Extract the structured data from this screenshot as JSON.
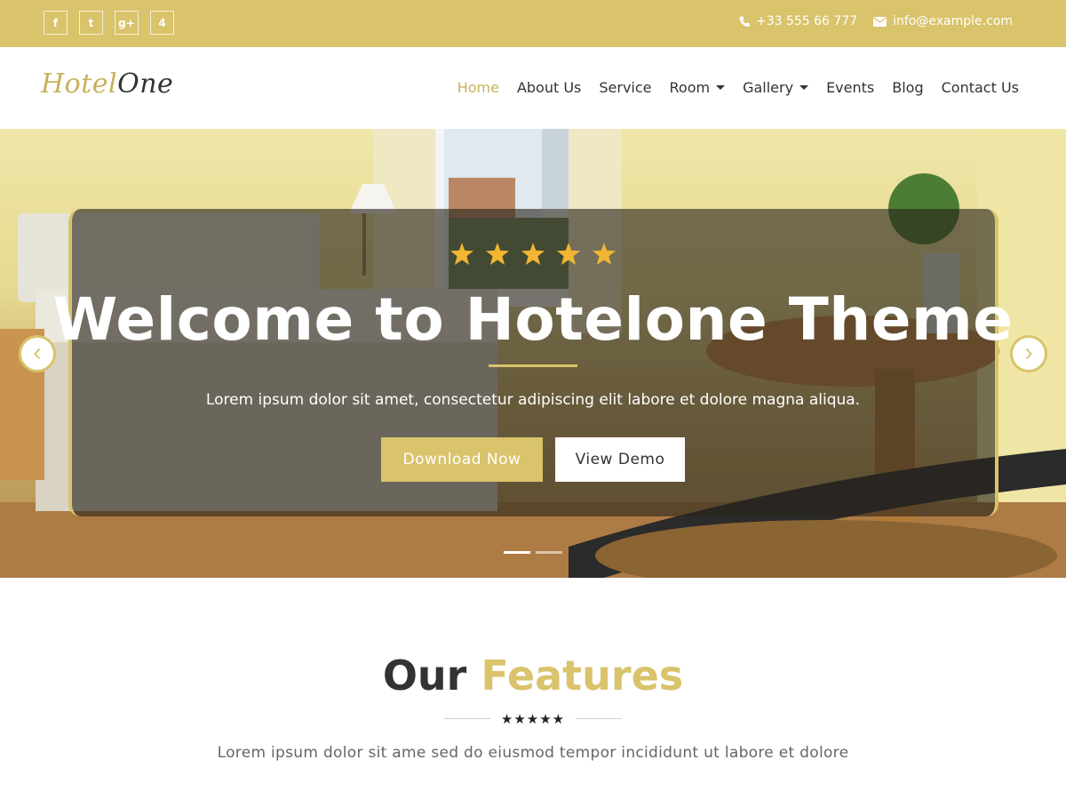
{
  "topbar": {
    "social": [
      {
        "label": "f",
        "icon": "facebook-icon"
      },
      {
        "label": "t",
        "icon": "twitter-icon"
      },
      {
        "label": "g+",
        "icon": "google-plus-icon"
      },
      {
        "label": "4",
        "icon": "foursquare-icon"
      }
    ],
    "phone": "+33 555 66 777",
    "email": "info@example.com",
    "background": "#d9c36b"
  },
  "header": {
    "logo_part1": "Hotel",
    "logo_part2": "One",
    "nav": [
      {
        "label": "Home",
        "active": true
      },
      {
        "label": "About Us"
      },
      {
        "label": "Service"
      },
      {
        "label": "Room",
        "dropdown": true
      },
      {
        "label": "Gallery",
        "dropdown": true
      },
      {
        "label": "Events"
      },
      {
        "label": "Blog"
      },
      {
        "label": "Contact Us"
      }
    ]
  },
  "hero": {
    "rating_stars": 5,
    "title": "Welcome to Hotelone Theme",
    "subtitle": "Lorem ipsum dolor sit amet, consectetur adipiscing elit labore et dolore magna aliqua.",
    "primary_button": "Download Now",
    "secondary_button": "View Demo",
    "slides": 2,
    "active_slide": 1,
    "accent": "#d9c36b"
  },
  "features": {
    "title_part1": "Our",
    "title_part2": "Features",
    "stars": "★★★★★",
    "subtitle": "Lorem ipsum dolor sit ame sed do eiusmod tempor incididunt ut labore et dolore"
  }
}
